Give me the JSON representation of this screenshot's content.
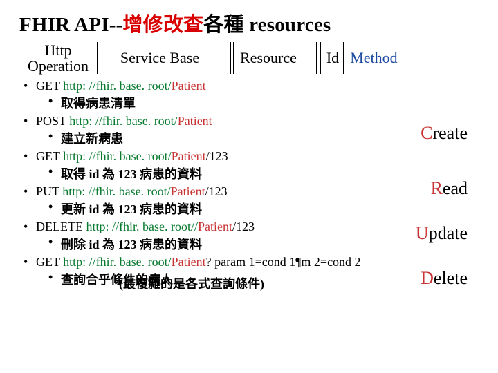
{
  "title": {
    "pre": "FHIR API--",
    "red": "增修改查",
    "post": "各種 resources"
  },
  "header": {
    "httpop": "Http\nOperation",
    "sbase": "Service Base",
    "resource": "Resource",
    "id": "Id",
    "method": "Method"
  },
  "crud": {
    "c": "Create",
    "r": "Read",
    "u": "Update",
    "d": "Delete"
  },
  "items": [
    {
      "verb": "GET ",
      "base": "http: //fhir. base. root/",
      "res": "Patient",
      "rest": "",
      "desc": "取得病患清單"
    },
    {
      "verb": "POST ",
      "base": "http: //fhir. base. root/",
      "res": "Patient",
      "rest": "",
      "desc": "建立新病患"
    },
    {
      "verb": "GET ",
      "base": "http: //fhir. base. root/",
      "res": "Patient",
      "rest": "/123",
      "desc": "取得  id 為 123 病患的資料"
    },
    {
      "verb": "PUT ",
      "base": "http: //fhir. base. root/",
      "res": "Patient",
      "rest": "/123",
      "desc": "更新 id 為 123 病患的資料"
    },
    {
      "verb": "DELETE ",
      "base": "http: //fhir. base. root//",
      "res": "Patient",
      "rest": "/123",
      "desc": "刪除 id 為 123 病患的資料"
    },
    {
      "verb": "GET ",
      "base": "http: //fhir. base. root/",
      "res": "Patient",
      "rest": "? param 1=cond 1&param 2=cond 2",
      "desc": "查詢合乎條件的病人"
    }
  ],
  "note": "(最複雜的是各式查詢條件)"
}
